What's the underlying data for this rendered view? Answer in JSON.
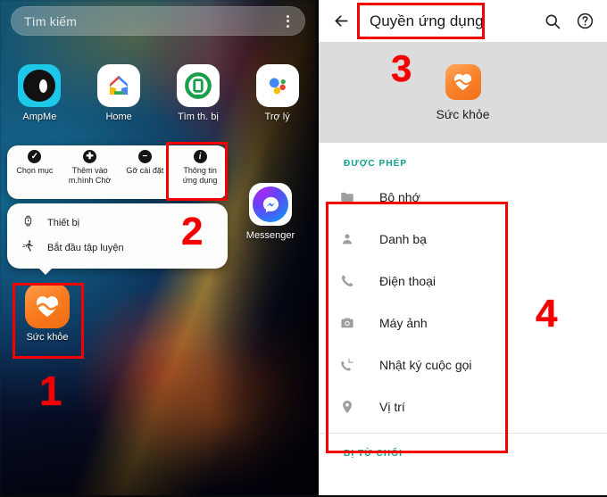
{
  "left_panel": {
    "search": {
      "placeholder": "Tìm kiếm",
      "menu_icon": "three-dots-vertical-icon"
    },
    "apps": [
      {
        "label": "AmpMe",
        "icon": "ampme-icon"
      },
      {
        "label": "Home",
        "icon": "google-home-icon"
      },
      {
        "label": "Tìm th. bị",
        "icon": "find-my-device-icon"
      },
      {
        "label": "Trợ lý",
        "icon": "google-assistant-icon"
      }
    ],
    "messenger": {
      "label": "Messenger",
      "icon": "messenger-icon"
    },
    "context_menu": [
      {
        "label": "Chọn mục",
        "icon": "check-circle-icon",
        "glyph": "✔"
      },
      {
        "label": "Thêm vào\nm.hình Chờ",
        "icon": "add-home-icon",
        "glyph": "✚"
      },
      {
        "label": "Gỡ cài đặt",
        "icon": "uninstall-icon",
        "glyph": "−"
      },
      {
        "label": "Thông tin\nứng dụng",
        "icon": "app-info-icon",
        "glyph": "i"
      }
    ],
    "shortcuts": [
      {
        "label": "Thiết bị",
        "icon": "watch-icon"
      },
      {
        "label": "Bắt đầu tập luyện",
        "icon": "running-person-icon"
      }
    ],
    "health_app": {
      "label": "Sức khỏe",
      "icon": "samsung-health-icon"
    }
  },
  "right_panel": {
    "topbar": {
      "back_icon": "arrow-left-icon",
      "title": "Quyền ứng dụng",
      "search_icon": "search-icon",
      "help_icon": "help-circle-icon"
    },
    "app_header": {
      "name": "Sức khỏe",
      "icon": "samsung-health-icon"
    },
    "allowed_section_label": "ĐƯỢC PHÉP",
    "denied_section_label": "BỊ TỪ CHỐI",
    "permissions": [
      {
        "label": "Bộ nhớ",
        "icon": "folder-icon"
      },
      {
        "label": "Danh bạ",
        "icon": "contacts-person-icon"
      },
      {
        "label": "Điện thoại",
        "icon": "phone-icon"
      },
      {
        "label": "Máy ảnh",
        "icon": "camera-icon"
      },
      {
        "label": "Nhật ký cuộc gọi",
        "icon": "call-log-icon"
      },
      {
        "label": "Vị trí",
        "icon": "location-pin-icon"
      }
    ]
  },
  "annotations": [
    {
      "number": "1"
    },
    {
      "number": "2"
    },
    {
      "number": "3"
    },
    {
      "number": "4"
    }
  ],
  "colors": {
    "annotation_red": "#f20000",
    "section_teal": "#10a08a",
    "health_orange": "#f8822a"
  }
}
